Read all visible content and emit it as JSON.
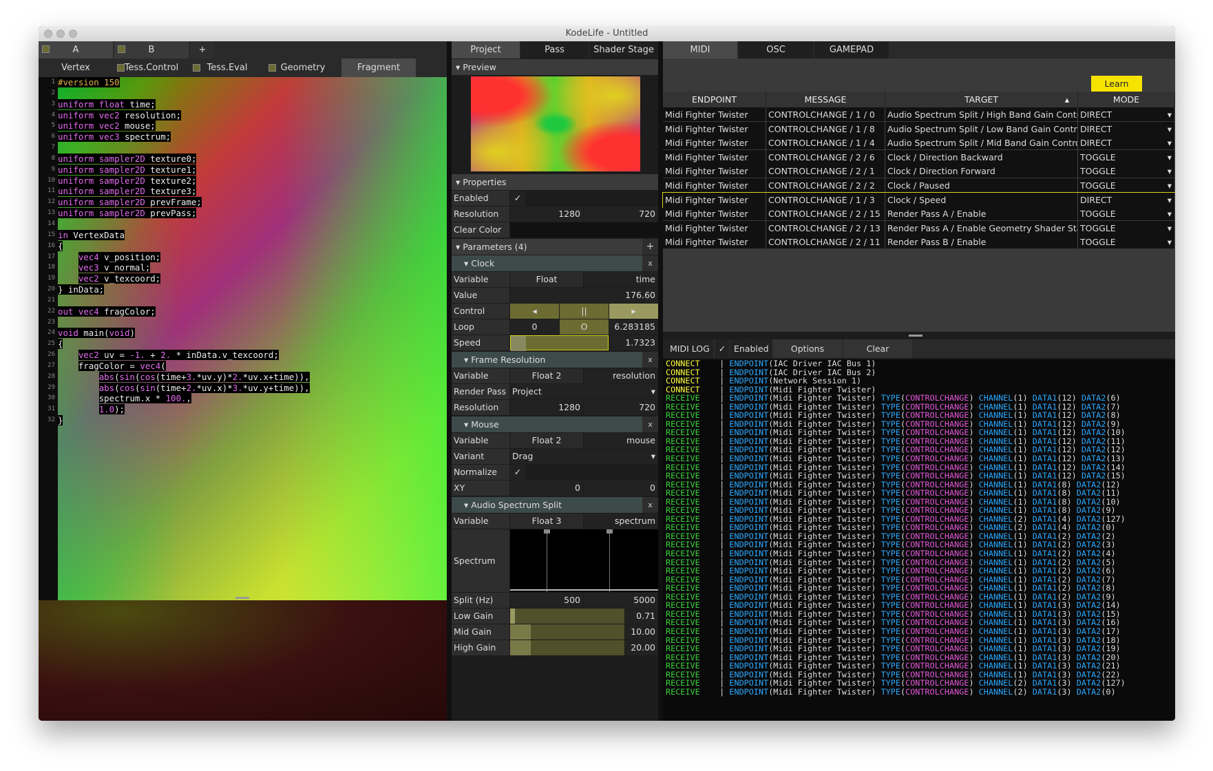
{
  "window": {
    "title": "KodeLife - Untitled"
  },
  "pass_tabs": [
    {
      "label": "A",
      "checked": true
    },
    {
      "label": "B",
      "checked": true
    },
    {
      "label": "+"
    }
  ],
  "stage_tabs": [
    {
      "label": "Vertex"
    },
    {
      "label": "Tess.Control"
    },
    {
      "label": "Tess.Eval"
    },
    {
      "label": "Geometry"
    },
    {
      "label": "Fragment"
    }
  ],
  "code_lines": [
    "#version 150",
    "",
    "uniform float time;",
    "uniform vec2 resolution;",
    "uniform vec2 mouse;",
    "uniform vec3 spectrum;",
    "",
    "uniform sampler2D texture0;",
    "uniform sampler2D texture1;",
    "uniform sampler2D texture2;",
    "uniform sampler2D texture3;",
    "uniform sampler2D prevFrame;",
    "uniform sampler2D prevPass;",
    "",
    "in VertexData",
    "{",
    "    vec4 v_position;",
    "    vec3 v_normal;",
    "    vec2 v_texcoord;",
    "} inData;",
    "",
    "out vec4 fragColor;",
    "",
    "void main(void)",
    "{",
    "    vec2 uv = -1. + 2. * inData.v_texcoord;",
    "    fragColor = vec4(",
    "        abs(sin(cos(time+3.*uv.y)*2.*uv.x+time)),",
    "        abs(cos(sin(time+2.*uv.x)*3.*uv.y+time)),",
    "        spectrum.x * 100.,",
    "        1.0);",
    "}"
  ],
  "mid_tabs": [
    {
      "label": "Project"
    },
    {
      "label": "Pass"
    },
    {
      "label": "Shader Stage"
    }
  ],
  "preview": {
    "label": "Preview"
  },
  "properties": {
    "label": "Properties",
    "enabled_label": "Enabled",
    "enabled_check": "✓",
    "resolution_label": "Resolution",
    "res_w": "1280",
    "res_h": "720",
    "clear_color_label": "Clear Color"
  },
  "parameters": {
    "label": "Parameters (4)",
    "add": "+"
  },
  "clock": {
    "label": "Clock",
    "close": "x",
    "variable_label": "Variable",
    "type": "Float",
    "name": "time",
    "value_label": "Value",
    "value": "176.60",
    "control_label": "Control",
    "rewind": "◂",
    "pause": "||",
    "play": "▸",
    "loop_label": "Loop",
    "loop_start": "0",
    "loop_mode": "O",
    "loop_end": "6.283185",
    "speed_label": "Speed",
    "speed": "1.7323",
    "speed_fraction": 0.1
  },
  "frame_resolution": {
    "label": "Frame Resolution",
    "close": "x",
    "variable_label": "Variable",
    "type": "Float 2",
    "name": "resolution",
    "render_pass_label": "Render Pass",
    "render_pass": "Project",
    "dropdown": "▾",
    "resolution_label": "Resolution",
    "w": "1280",
    "h": "720"
  },
  "mouse": {
    "label": "Mouse",
    "close": "x",
    "variable_label": "Variable",
    "type": "Float 2",
    "name": "mouse",
    "variant_label": "Variant",
    "variant": "Drag",
    "dropdown": "▾",
    "normalize_label": "Normalize",
    "normalize_check": "✓",
    "xy_label": "XY",
    "x": "0",
    "y": "0"
  },
  "audio": {
    "label": "Audio Spectrum Split",
    "close": "x",
    "variable_label": "Variable",
    "type": "Float 3",
    "name": "spectrum",
    "spectrum_label": "Spectrum",
    "split_label": "Split (Hz)",
    "split_low": "500",
    "split_high": "5000",
    "low_gain_label": "Low Gain",
    "low_gain": "0.71",
    "low_gain_fraction": 0.04,
    "mid_gain_label": "Mid Gain",
    "mid_gain": "10.00",
    "mid_gain_fraction": 0.18,
    "high_gain_label": "High Gain",
    "high_gain": "20.00",
    "high_gain_fraction": 0.18
  },
  "right_tabs": [
    {
      "label": "MIDI"
    },
    {
      "label": "OSC"
    },
    {
      "label": "GAMEPAD"
    }
  ],
  "learn_button": "Learn",
  "midi_table": {
    "headers": [
      "ENDPOINT",
      "MESSAGE",
      "TARGET",
      "MODE"
    ],
    "sort_indicator": "▴",
    "rows": [
      [
        "Midi Fighter Twister",
        "CONTROLCHANGE / 1 / 0",
        "Audio Spectrum Split / High Band Gain Control",
        "DIRECT"
      ],
      [
        "Midi Fighter Twister",
        "CONTROLCHANGE / 1 / 8",
        "Audio Spectrum Split / Low Band Gain Control",
        "DIRECT"
      ],
      [
        "Midi Fighter Twister",
        "CONTROLCHANGE / 1 / 4",
        "Audio Spectrum Split / Mid Band Gain Control",
        "DIRECT"
      ],
      [
        "Midi Fighter Twister",
        "CONTROLCHANGE / 2 / 6",
        "Clock / Direction Backward",
        "TOGGLE"
      ],
      [
        "Midi Fighter Twister",
        "CONTROLCHANGE / 2 / 1",
        "Clock / Direction Forward",
        "TOGGLE"
      ],
      [
        "Midi Fighter Twister",
        "CONTROLCHANGE / 2 / 2",
        "Clock / Paused",
        "TOGGLE"
      ],
      [
        "Midi Fighter Twister",
        "CONTROLCHANGE / 1 / 3",
        "Clock / Speed",
        "DIRECT"
      ],
      [
        "Midi Fighter Twister",
        "CONTROLCHANGE / 2 / 15",
        "Render Pass A / Enable",
        "TOGGLE"
      ],
      [
        "Midi Fighter Twister",
        "CONTROLCHANGE / 2 / 13",
        "Render Pass A / Enable Geometry Shader Stage",
        "TOGGLE"
      ],
      [
        "Midi Fighter Twister",
        "CONTROLCHANGE / 2 / 11",
        "Render Pass B / Enable",
        "TOGGLE"
      ]
    ],
    "selected_row": 6,
    "dropdown": "▾"
  },
  "midi_log": {
    "label": "MIDI LOG",
    "enabled_check": "✓",
    "enabled_label": "Enabled",
    "options": "Options",
    "clear": "Clear",
    "connects": [
      "IAC Driver IAC Bus 1",
      "IAC Driver IAC Bus 2",
      "Network Session 1",
      "Midi Fighter Twister"
    ],
    "receives": [
      [
        "1",
        "12",
        "6"
      ],
      [
        "1",
        "12",
        "7"
      ],
      [
        "1",
        "12",
        "8"
      ],
      [
        "1",
        "12",
        "9"
      ],
      [
        "1",
        "12",
        "10"
      ],
      [
        "1",
        "12",
        "11"
      ],
      [
        "1",
        "12",
        "12"
      ],
      [
        "1",
        "12",
        "13"
      ],
      [
        "1",
        "12",
        "14"
      ],
      [
        "1",
        "12",
        "15"
      ],
      [
        "1",
        "8",
        "12"
      ],
      [
        "1",
        "8",
        "11"
      ],
      [
        "1",
        "8",
        "10"
      ],
      [
        "1",
        "8",
        "9"
      ],
      [
        "2",
        "4",
        "127"
      ],
      [
        "2",
        "4",
        "0"
      ],
      [
        "1",
        "2",
        "2"
      ],
      [
        "1",
        "2",
        "3"
      ],
      [
        "1",
        "2",
        "4"
      ],
      [
        "1",
        "2",
        "5"
      ],
      [
        "1",
        "2",
        "6"
      ],
      [
        "1",
        "2",
        "7"
      ],
      [
        "1",
        "2",
        "8"
      ],
      [
        "1",
        "2",
        "9"
      ],
      [
        "1",
        "3",
        "14"
      ],
      [
        "1",
        "3",
        "15"
      ],
      [
        "1",
        "3",
        "16"
      ],
      [
        "1",
        "3",
        "17"
      ],
      [
        "1",
        "3",
        "18"
      ],
      [
        "1",
        "3",
        "19"
      ],
      [
        "1",
        "3",
        "20"
      ],
      [
        "1",
        "3",
        "21"
      ],
      [
        "1",
        "3",
        "22"
      ],
      [
        "2",
        "3",
        "127"
      ],
      [
        "2",
        "3",
        "0"
      ]
    ],
    "connect_word": "CONNECT",
    "receive_word": "RECEIVE",
    "endpoint_word": "ENDPOINT",
    "device": "Midi Fighter Twister",
    "type_word": "TYPE",
    "cc_word": "CONTROLCHANGE",
    "channel_word": "CHANNEL",
    "data1_word": "DATA1",
    "data2_word": "DATA2"
  }
}
